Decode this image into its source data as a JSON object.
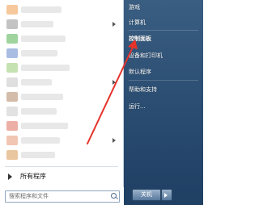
{
  "program_list": {
    "items": [
      {
        "color": "#f0a35a",
        "has_submenu": false
      },
      {
        "color": "#9b9b9b",
        "has_submenu": true
      },
      {
        "color": "#5fb85f",
        "has_submenu": false
      },
      {
        "color": "#6f8fcf",
        "has_submenu": false
      },
      {
        "color": "#9fcf7f",
        "has_submenu": false
      },
      {
        "color": "#c9c9c9",
        "has_submenu": true
      },
      {
        "color": "#b58f6f",
        "has_submenu": false
      },
      {
        "color": "#cfcfcf",
        "has_submenu": false
      },
      {
        "color": "#e07a6a",
        "has_submenu": false
      },
      {
        "color": "#e8a080",
        "has_submenu": true
      },
      {
        "color": "#dba060",
        "has_submenu": false
      },
      {
        "color": "#6fb0df",
        "has_submenu": false
      }
    ],
    "all_programs_label": "所有程序"
  },
  "search": {
    "placeholder": "搜索程序和文件"
  },
  "right_pane": {
    "items": [
      "游戏",
      "计算机",
      "控制面板",
      "设备和打印机",
      "默认程序",
      "帮助和支持",
      "运行..."
    ],
    "highlighted": "控制面板"
  },
  "shutdown": {
    "label": "关机"
  },
  "annotation": {
    "color": "#e5332a"
  }
}
